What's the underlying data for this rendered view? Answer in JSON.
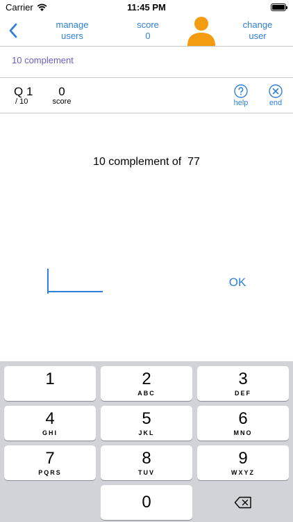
{
  "status_bar": {
    "carrier": "Carrier",
    "time": "11:45 PM"
  },
  "nav": {
    "manage_line1": "manage",
    "manage_line2": "users",
    "score_label": "score",
    "score_value": "0",
    "change_line1": "change",
    "change_line2": "user",
    "avatar_color": "#f39c12"
  },
  "mode": "10 complement",
  "quiz": {
    "question_number": "Q 1",
    "question_total": "/ 10",
    "score_value": "0",
    "score_caption": "score",
    "help_label": "help",
    "end_label": "end"
  },
  "question": {
    "prefix": "10 complement of",
    "number": "77"
  },
  "answer": {
    "value": ""
  },
  "ok_label": "OK",
  "keypad": {
    "keys": [
      {
        "digit": "1",
        "letters": ""
      },
      {
        "digit": "2",
        "letters": "ABC"
      },
      {
        "digit": "3",
        "letters": "DEF"
      },
      {
        "digit": "4",
        "letters": "GHI"
      },
      {
        "digit": "5",
        "letters": "JKL"
      },
      {
        "digit": "6",
        "letters": "MNO"
      },
      {
        "digit": "7",
        "letters": "PQRS"
      },
      {
        "digit": "8",
        "letters": "TUV"
      },
      {
        "digit": "9",
        "letters": "WXYZ"
      }
    ],
    "zero": "0"
  },
  "colors": {
    "accent": "#2f80d8",
    "mode_text": "#6b5bc3",
    "keypad_bg": "#d1d3d9"
  }
}
